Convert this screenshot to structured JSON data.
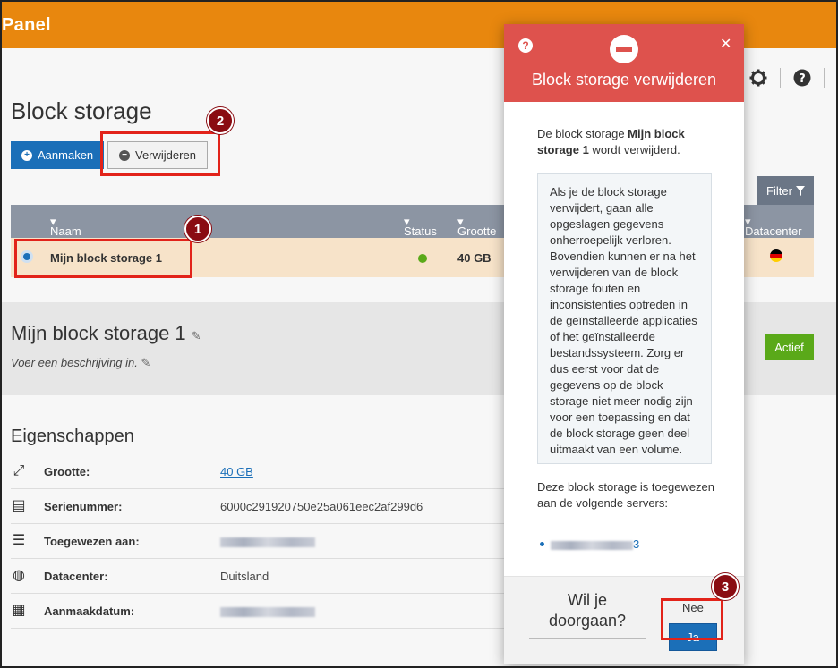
{
  "app": {
    "brand": "Panel"
  },
  "page": {
    "title": "Block storage"
  },
  "toolbar": {
    "create_label": "Aanmaken",
    "delete_label": "Verwijderen",
    "filter_label": "Filter"
  },
  "table": {
    "headers": {
      "name": "Naam",
      "status": "Status",
      "size": "Grootte",
      "datacenter": "Datacenter"
    },
    "rows": [
      {
        "name": "Mijn block storage 1",
        "size": "40 GB"
      }
    ]
  },
  "detail": {
    "title": "Mijn block storage 1",
    "description_placeholder": "Voer een beschrijving in.",
    "status_label": "Actief"
  },
  "properties": {
    "title": "Eigenschappen",
    "items": [
      {
        "label": "Grootte:",
        "value": "40 GB"
      },
      {
        "label": "Serienummer:",
        "value": "6000c291920750e25a061eec2af299d6"
      },
      {
        "label": "Toegewezen aan:",
        "value": ""
      },
      {
        "label": "Datacenter:",
        "value": "Duitsland"
      },
      {
        "label": "Aanmaakdatum:",
        "value": ""
      }
    ]
  },
  "modal": {
    "title": "Block storage verwijderen",
    "intro_prefix": "De block storage ",
    "intro_name": "Mijn block storage 1",
    "intro_suffix": " wordt verwijderd.",
    "warning": "Als je de block storage verwijdert, gaan alle opgeslagen gegevens onherroepelijk verloren. Bovendien kunnen er na het verwijderen van de block storage fouten en inconsistenties optreden in de geïnstalleerde applicaties of het geïnstalleerde bestandssysteem. Zorg er dus eerst voor dat de gegevens op de block storage niet meer nodig zijn voor een toepassing en dat de block storage geen deel uitmaakt van een volume.",
    "assigned_text": "Deze block storage is toegewezen aan de volgende servers:",
    "server_suffix": "3",
    "question": "Wil je doorgaan?",
    "no_label": "Nee",
    "yes_label": "Ja"
  },
  "annotations": {
    "badge_1": "1",
    "badge_2": "2",
    "badge_3": "3"
  },
  "colors": {
    "brand": "#e8870e",
    "primary": "#1b6fb8",
    "danger": "#de524d",
    "success": "#5aa919",
    "callout": "#e2231a",
    "badge": "#8a0c12"
  },
  "icons": {
    "create": "plus-circle-icon",
    "delete": "minus-circle-icon",
    "filter": "funnel-icon",
    "settings": "gear-icon",
    "help": "question-circle-icon",
    "close": "close-icon",
    "stop": "no-entry-icon",
    "edit": "pencil-icon",
    "flag": "germany-flag-icon"
  }
}
